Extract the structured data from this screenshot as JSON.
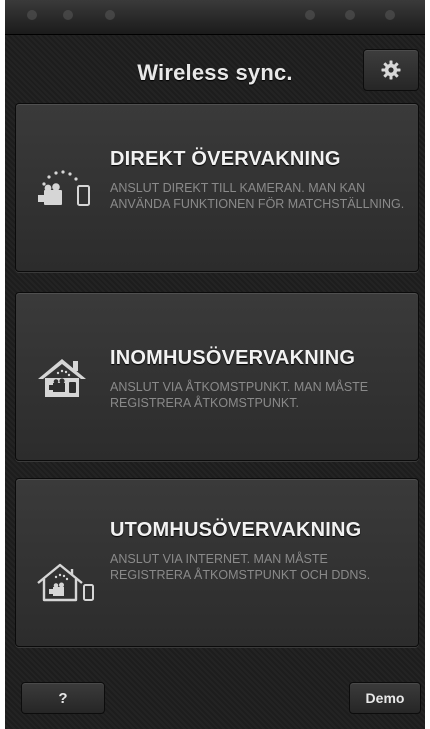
{
  "header": {
    "title": "Wireless sync.",
    "settings_icon": "gear-icon"
  },
  "modes": [
    {
      "title": "DIREKT ÖVERVAKNING",
      "description": "ANSLUT DIREKT TILL KAMERAN. MAN KAN ANVÄNDA FUNKTIONEN FÖR MATCHSTÄLLNING.",
      "icon": "camera-phone-direct-icon"
    },
    {
      "title": "INOMHUSÖVERVAKNING",
      "description": "ANSLUT VIA ÅTKOMSTPUNKT. MAN MÅSTE REGISTRERA ÅTKOMSTPUNKT.",
      "icon": "house-indoor-icon"
    },
    {
      "title": "UTOMHUSÖVERVAKNING",
      "description": "ANSLUT VIA INTERNET. MAN MÅSTE REGISTRERA ÅTKOMSTPUNKT OCH DDNS.",
      "icon": "house-outdoor-icon"
    }
  ],
  "footer": {
    "help_label": "?",
    "demo_label": "Demo"
  },
  "colors": {
    "background": "#1f1f1f",
    "card": "#343434",
    "title_text": "#f2f2f2",
    "description_text": "#8a8a8a"
  }
}
